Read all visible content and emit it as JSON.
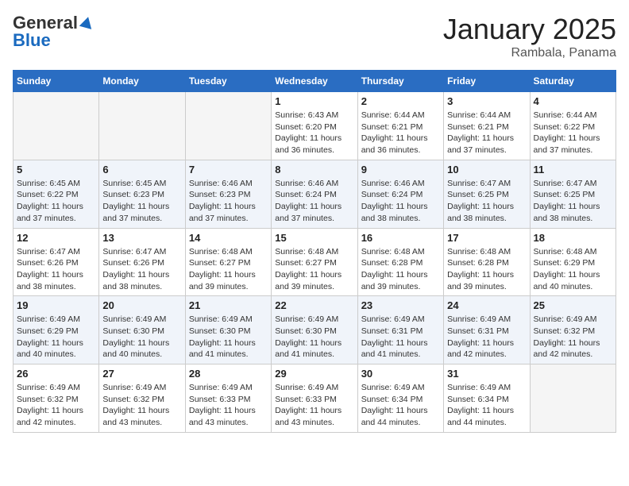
{
  "header": {
    "logo_general": "General",
    "logo_blue": "Blue",
    "month_title": "January 2025",
    "subtitle": "Rambala, Panama"
  },
  "weekdays": [
    "Sunday",
    "Monday",
    "Tuesday",
    "Wednesday",
    "Thursday",
    "Friday",
    "Saturday"
  ],
  "weeks": [
    [
      {
        "day": "",
        "info": ""
      },
      {
        "day": "",
        "info": ""
      },
      {
        "day": "",
        "info": ""
      },
      {
        "day": "1",
        "info": "Sunrise: 6:43 AM\nSunset: 6:20 PM\nDaylight: 11 hours and 36 minutes."
      },
      {
        "day": "2",
        "info": "Sunrise: 6:44 AM\nSunset: 6:21 PM\nDaylight: 11 hours and 36 minutes."
      },
      {
        "day": "3",
        "info": "Sunrise: 6:44 AM\nSunset: 6:21 PM\nDaylight: 11 hours and 37 minutes."
      },
      {
        "day": "4",
        "info": "Sunrise: 6:44 AM\nSunset: 6:22 PM\nDaylight: 11 hours and 37 minutes."
      }
    ],
    [
      {
        "day": "5",
        "info": "Sunrise: 6:45 AM\nSunset: 6:22 PM\nDaylight: 11 hours and 37 minutes."
      },
      {
        "day": "6",
        "info": "Sunrise: 6:45 AM\nSunset: 6:23 PM\nDaylight: 11 hours and 37 minutes."
      },
      {
        "day": "7",
        "info": "Sunrise: 6:46 AM\nSunset: 6:23 PM\nDaylight: 11 hours and 37 minutes."
      },
      {
        "day": "8",
        "info": "Sunrise: 6:46 AM\nSunset: 6:24 PM\nDaylight: 11 hours and 37 minutes."
      },
      {
        "day": "9",
        "info": "Sunrise: 6:46 AM\nSunset: 6:24 PM\nDaylight: 11 hours and 38 minutes."
      },
      {
        "day": "10",
        "info": "Sunrise: 6:47 AM\nSunset: 6:25 PM\nDaylight: 11 hours and 38 minutes."
      },
      {
        "day": "11",
        "info": "Sunrise: 6:47 AM\nSunset: 6:25 PM\nDaylight: 11 hours and 38 minutes."
      }
    ],
    [
      {
        "day": "12",
        "info": "Sunrise: 6:47 AM\nSunset: 6:26 PM\nDaylight: 11 hours and 38 minutes."
      },
      {
        "day": "13",
        "info": "Sunrise: 6:47 AM\nSunset: 6:26 PM\nDaylight: 11 hours and 38 minutes."
      },
      {
        "day": "14",
        "info": "Sunrise: 6:48 AM\nSunset: 6:27 PM\nDaylight: 11 hours and 39 minutes."
      },
      {
        "day": "15",
        "info": "Sunrise: 6:48 AM\nSunset: 6:27 PM\nDaylight: 11 hours and 39 minutes."
      },
      {
        "day": "16",
        "info": "Sunrise: 6:48 AM\nSunset: 6:28 PM\nDaylight: 11 hours and 39 minutes."
      },
      {
        "day": "17",
        "info": "Sunrise: 6:48 AM\nSunset: 6:28 PM\nDaylight: 11 hours and 39 minutes."
      },
      {
        "day": "18",
        "info": "Sunrise: 6:48 AM\nSunset: 6:29 PM\nDaylight: 11 hours and 40 minutes."
      }
    ],
    [
      {
        "day": "19",
        "info": "Sunrise: 6:49 AM\nSunset: 6:29 PM\nDaylight: 11 hours and 40 minutes."
      },
      {
        "day": "20",
        "info": "Sunrise: 6:49 AM\nSunset: 6:30 PM\nDaylight: 11 hours and 40 minutes."
      },
      {
        "day": "21",
        "info": "Sunrise: 6:49 AM\nSunset: 6:30 PM\nDaylight: 11 hours and 41 minutes."
      },
      {
        "day": "22",
        "info": "Sunrise: 6:49 AM\nSunset: 6:30 PM\nDaylight: 11 hours and 41 minutes."
      },
      {
        "day": "23",
        "info": "Sunrise: 6:49 AM\nSunset: 6:31 PM\nDaylight: 11 hours and 41 minutes."
      },
      {
        "day": "24",
        "info": "Sunrise: 6:49 AM\nSunset: 6:31 PM\nDaylight: 11 hours and 42 minutes."
      },
      {
        "day": "25",
        "info": "Sunrise: 6:49 AM\nSunset: 6:32 PM\nDaylight: 11 hours and 42 minutes."
      }
    ],
    [
      {
        "day": "26",
        "info": "Sunrise: 6:49 AM\nSunset: 6:32 PM\nDaylight: 11 hours and 42 minutes."
      },
      {
        "day": "27",
        "info": "Sunrise: 6:49 AM\nSunset: 6:32 PM\nDaylight: 11 hours and 43 minutes."
      },
      {
        "day": "28",
        "info": "Sunrise: 6:49 AM\nSunset: 6:33 PM\nDaylight: 11 hours and 43 minutes."
      },
      {
        "day": "29",
        "info": "Sunrise: 6:49 AM\nSunset: 6:33 PM\nDaylight: 11 hours and 43 minutes."
      },
      {
        "day": "30",
        "info": "Sunrise: 6:49 AM\nSunset: 6:34 PM\nDaylight: 11 hours and 44 minutes."
      },
      {
        "day": "31",
        "info": "Sunrise: 6:49 AM\nSunset: 6:34 PM\nDaylight: 11 hours and 44 minutes."
      },
      {
        "day": "",
        "info": ""
      }
    ]
  ]
}
